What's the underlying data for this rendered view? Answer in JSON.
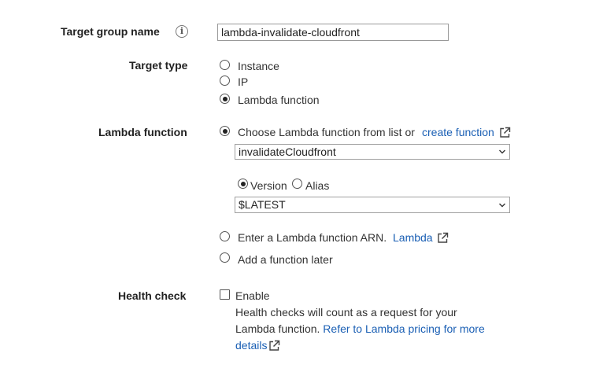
{
  "target_group_name": {
    "label": "Target group name",
    "info_icon": "info-icon",
    "value": "lambda-invalidate-cloudfront"
  },
  "target_type": {
    "label": "Target type",
    "options": [
      {
        "label": "Instance",
        "selected": false
      },
      {
        "label": "IP",
        "selected": false
      },
      {
        "label": "Lambda function",
        "selected": true
      }
    ]
  },
  "lambda_function": {
    "label": "Lambda function",
    "choose_option": {
      "label": "Choose Lambda function from list or",
      "link": "create function",
      "selected": true
    },
    "function_select": {
      "value": "invalidateCloudfront"
    },
    "version_alias": {
      "version_label": "Version",
      "alias_label": "Alias",
      "selected": "Version"
    },
    "version_select": {
      "value": "$LATEST"
    },
    "arn_option": {
      "label": "Enter a Lambda function ARN.",
      "link": "Lambda",
      "selected": false
    },
    "later_option": {
      "label": "Add a function later",
      "selected": false
    }
  },
  "health_check": {
    "label": "Health check",
    "enable_label": "Enable",
    "enabled": false,
    "help_line1": "Health checks will count as a request for your",
    "help_line2_prefix": "Lambda function.",
    "help_link_part1": "Refer to Lambda pricing for more",
    "help_link_part2": "details"
  },
  "icons": {
    "external_link": "external-link-icon",
    "dropdown": "chevron-down-icon"
  }
}
